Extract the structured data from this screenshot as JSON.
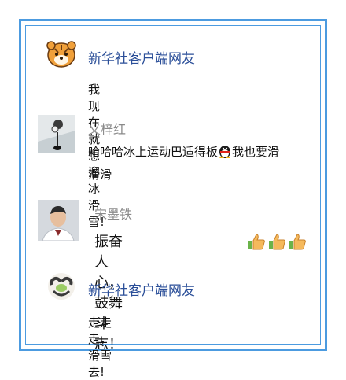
{
  "comments": [
    {
      "name": "新华社客户端网友",
      "text": "我现在就想溜冰滑雪!",
      "avatar": "tiger-cartoon-avatar"
    },
    {
      "name": "义梓红",
      "text_a": "哈哈哈冰上运动巴适得板",
      "text_b": "我也要滑",
      "text_c": "滑滑",
      "avatar": "photo-avatar"
    },
    {
      "name": "宋墨铁",
      "text": "振奋人心，鼓舞斗志！",
      "avatar": "person-photo-avatar"
    },
    {
      "name": "新华社客户端网友",
      "text": "走走走，滑雪去!",
      "avatar": "heart-hands-avatar"
    }
  ],
  "colors": {
    "frame": "#4c9be0",
    "name_blue": "#2a4e98",
    "name_gray": "#8a8a8a"
  },
  "icons": [
    "penguin-emoji-icon",
    "thumbs-up-icon"
  ]
}
